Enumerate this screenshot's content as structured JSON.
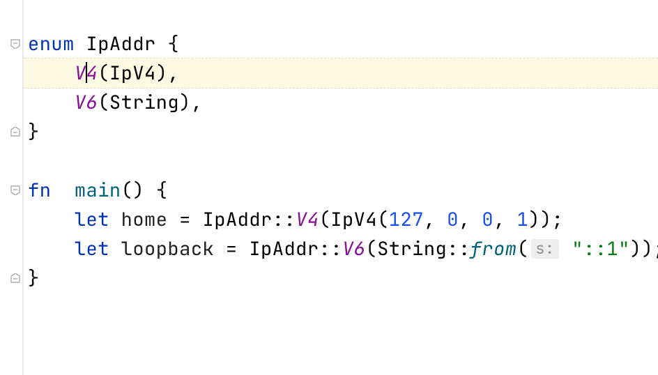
{
  "code": {
    "line1": {
      "kw": "enum",
      "type": "IpAddr",
      "brace": " {"
    },
    "line2": {
      "indent": "    ",
      "variant_pre": "V",
      "variant_post": "4",
      "paren_open": "(",
      "inner_type": "IpV4",
      "close": "),",
      "cursor_line": true
    },
    "line3": {
      "indent": "    ",
      "variant": "V6",
      "paren_open": "(",
      "inner_type": "String",
      "close": "),"
    },
    "line4": {
      "text": "}"
    },
    "line5": {
      "text": ""
    },
    "line6": {
      "kw": "fn",
      "sp": "  ",
      "fname": "main",
      "rest": "() {"
    },
    "line7": {
      "indent": "    ",
      "let": "let",
      "var": "home",
      "eq": " = ",
      "t1": "IpAddr",
      "cc": "::",
      "v": "V4",
      "po": "(",
      "t2": "IpV4",
      "po2": "(",
      "n1": "127",
      "c1": ", ",
      "n2": "0",
      "c2": ", ",
      "n3": "0",
      "c3": ", ",
      "n4": "1",
      "close": "));"
    },
    "line8": {
      "indent": "    ",
      "let": "let",
      "var": "loopback",
      "eq": " = ",
      "t1": "IpAddr",
      "cc": "::",
      "v": "V6",
      "po": "(",
      "t2": "String",
      "cc2": "::",
      "fn": "from",
      "po2": "(",
      "hint": "s:",
      "sp": " ",
      "str": "\"::1\"",
      "close": "));"
    },
    "line9": {
      "text": "}"
    }
  },
  "gutter": {
    "fold_open_1": "fold-open",
    "fold_close_1": "fold-close",
    "fold_open_2": "fold-open",
    "fold_close_2": "fold-close"
  }
}
